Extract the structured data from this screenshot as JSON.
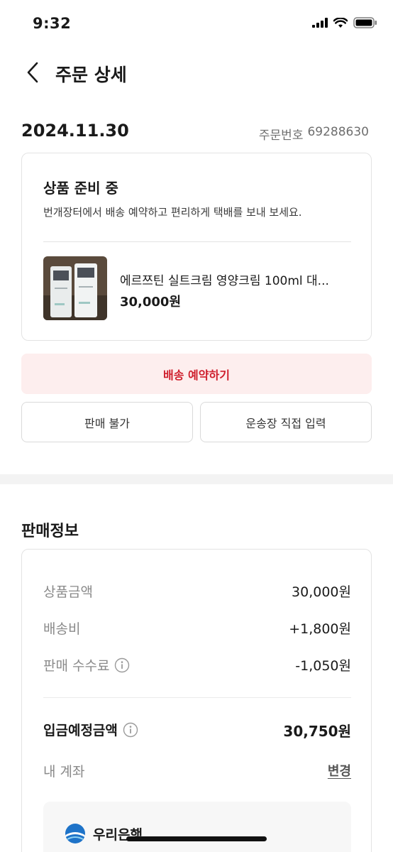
{
  "status_bar": {
    "time": "9:32"
  },
  "nav": {
    "title": "주문 상세"
  },
  "order": {
    "date": "2024.11.30",
    "number_label": "주문번호",
    "number_value": "69288630"
  },
  "status_card": {
    "title": "상품 준비 중",
    "description": "번개장터에서 배송 예약하고 편리하게 택배를 보내 보세요.",
    "product_name": "에르쯔틴 실트크림 영양크림 100ml 대...",
    "product_price": "30,000원"
  },
  "actions": {
    "primary": "배송 예약하기",
    "unavailable": "판매 불가",
    "tracking_input": "운송장 직접 입력"
  },
  "sales": {
    "title": "판매정보",
    "rows": [
      {
        "label": "상품금액",
        "value": "30,000원"
      },
      {
        "label": "배송비",
        "value": "+1,800원"
      },
      {
        "label": "판매 수수료",
        "value": "-1,050원"
      }
    ],
    "total_label": "입금예정금액",
    "total_value": "30,750원",
    "account_label": "내 계좌",
    "change_label": "변경",
    "bank_name": "우리은행"
  },
  "colors": {
    "accent": "#cf1f2d",
    "accent_bg": "#fdeeee",
    "bank_blue": "#1e73c8"
  }
}
